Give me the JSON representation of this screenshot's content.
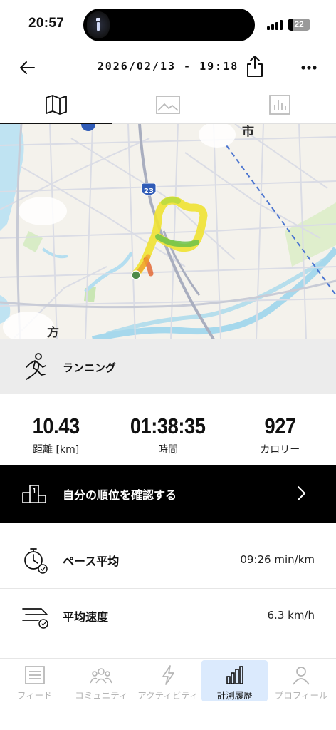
{
  "status_bar": {
    "time": "20:57",
    "battery": "22",
    "battery_level": 0.22
  },
  "header": {
    "title": "2026/02/13 - 19:18"
  },
  "view_tabs": [
    {
      "icon": "map-icon",
      "active": true
    },
    {
      "icon": "image-icon",
      "active": false
    },
    {
      "icon": "bar-chart-icon",
      "active": false
    }
  ],
  "map": {
    "road_badge": "23",
    "place_labels": [
      "市",
      "方"
    ],
    "route_colors": {
      "fast": "#6cc24a",
      "medium": "#f0e232",
      "slow": "#e2602a",
      "start_marker": "#4e8a4a"
    }
  },
  "activity": {
    "icon": "running-icon",
    "type_label": "ランニング"
  },
  "stats": [
    {
      "value": "10.43",
      "label": "距離 [km]"
    },
    {
      "value": "01:38:35",
      "label": "時間"
    },
    {
      "value": "927",
      "label": "カロリー"
    }
  ],
  "ranking": {
    "icon": "podium-icon",
    "label": "自分の順位を確認する"
  },
  "metrics": [
    {
      "icon": "stopwatch-icon",
      "label": "ペース平均",
      "value": "09:26 min/km"
    },
    {
      "icon": "speed-icon",
      "label": "平均速度",
      "value": "6.3 km/h"
    }
  ],
  "bottom_nav": [
    {
      "icon": "feed-icon",
      "label": "フィード",
      "active": false
    },
    {
      "icon": "community-icon",
      "label": "コミュニティ",
      "active": false
    },
    {
      "icon": "lightning-icon",
      "label": "アクティビティ",
      "active": false
    },
    {
      "icon": "bar-chart-icon",
      "label": "計測履歴",
      "active": true
    },
    {
      "icon": "profile-icon",
      "label": "プロフィール",
      "active": false
    }
  ],
  "colors": {
    "accent_nav_bg": "#dbeafd",
    "banner_bg": "#000000",
    "water": "#bfe3f2",
    "river": "#9fd6ec"
  }
}
